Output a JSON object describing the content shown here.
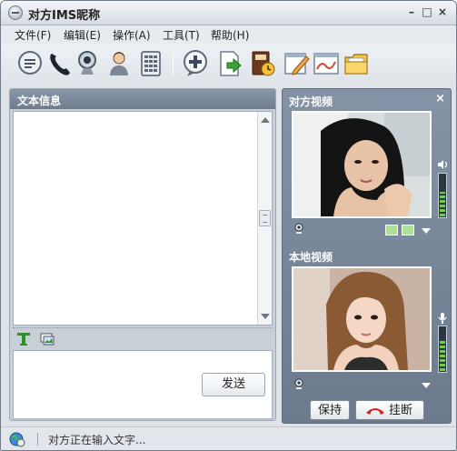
{
  "window": {
    "title": "对方IMS昵称"
  },
  "titlebar_buttons": {
    "minimize": "–",
    "maximize": "□",
    "close": "×"
  },
  "menu": [
    {
      "label": "文件(F)"
    },
    {
      "label": "编辑(E)"
    },
    {
      "label": "操作(A)"
    },
    {
      "label": "工具(T)"
    },
    {
      "label": "帮助(H)"
    }
  ],
  "toolbar": {
    "icons": [
      "chat-icon",
      "phone-icon",
      "webcam-icon",
      "contact-icon",
      "keypad-icon",
      "add-icon",
      "send-file-icon",
      "notebook-icon",
      "edit-icon",
      "whiteboard-icon",
      "folder-icon"
    ]
  },
  "left_panel": {
    "title": "文本信息",
    "send_label": "发送",
    "format_icons": [
      "font-icon",
      "screen-capture-icon"
    ]
  },
  "right_panel": {
    "remote_label": "对方视频",
    "local_label": "本地视频",
    "close_label": "×",
    "remote_volume_level": 0.6,
    "local_volume_level": 0.75,
    "hold_label": "保持",
    "hangup_label": "挂断"
  },
  "status": {
    "text": "对方正在输入文字..."
  },
  "colors": {
    "panel_header": "#7a8899",
    "volume_fill": "#6cd13b",
    "hangup_red": "#d42020"
  }
}
